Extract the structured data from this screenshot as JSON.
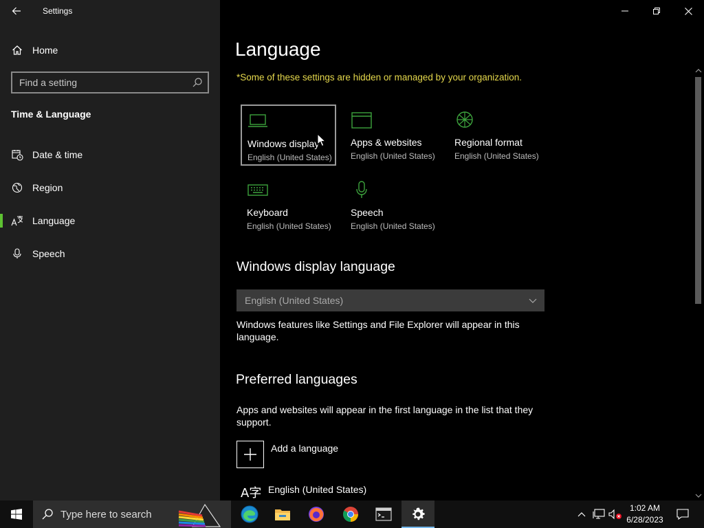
{
  "window": {
    "title": "Settings",
    "controls": {
      "minimize": "minimize",
      "restore": "restore",
      "close": "close"
    }
  },
  "sidebar": {
    "home_label": "Home",
    "search_placeholder": "Find a setting",
    "section_title": "Time & Language",
    "items": [
      {
        "label": "Date & time",
        "icon": "clock-calendar-icon"
      },
      {
        "label": "Region",
        "icon": "globe-icon"
      },
      {
        "label": "Language",
        "icon": "language-icon",
        "selected": true
      },
      {
        "label": "Speech",
        "icon": "microphone-icon"
      }
    ]
  },
  "main": {
    "title": "Language",
    "org_notice": "*Some of these settings are hidden or managed by your organization.",
    "tiles": [
      {
        "name": "Windows display",
        "sub": "English (United States)",
        "icon": "laptop-icon",
        "focused": true
      },
      {
        "name": "Apps & websites",
        "sub": "English (United States)",
        "icon": "browser-window-icon"
      },
      {
        "name": "Regional format",
        "sub": "English (United States)",
        "icon": "globe-format-icon"
      },
      {
        "name": "Keyboard",
        "sub": "English (United States)",
        "icon": "keyboard-icon"
      },
      {
        "name": "Speech",
        "sub": "English (United States)",
        "icon": "microphone-icon"
      }
    ],
    "display_language": {
      "heading": "Windows display language",
      "selected": "English (United States)",
      "description": "Windows features like Settings and File Explorer will appear in this language."
    },
    "preferred": {
      "heading": "Preferred languages",
      "description": "Apps and websites will appear in the first language in the list that they support.",
      "add_label": "Add a language",
      "languages": [
        {
          "name": "English (United States)",
          "glyph": "A字"
        }
      ]
    }
  },
  "taskbar": {
    "search_placeholder": "Type here to search",
    "apps": [
      "edge-icon",
      "file-explorer-icon",
      "firefox-icon",
      "chrome-icon",
      "terminal-icon",
      "settings-gear-icon"
    ],
    "active_app": "settings-gear-icon",
    "clock": {
      "time": "1:02 AM",
      "date": "6/28/2023"
    }
  },
  "colors": {
    "accent_green": "#5ec232",
    "notice_yellow": "#e5d84c",
    "sidebar_bg": "#1f1f1f",
    "main_bg": "#000000",
    "taskbar_bg": "#101010"
  }
}
